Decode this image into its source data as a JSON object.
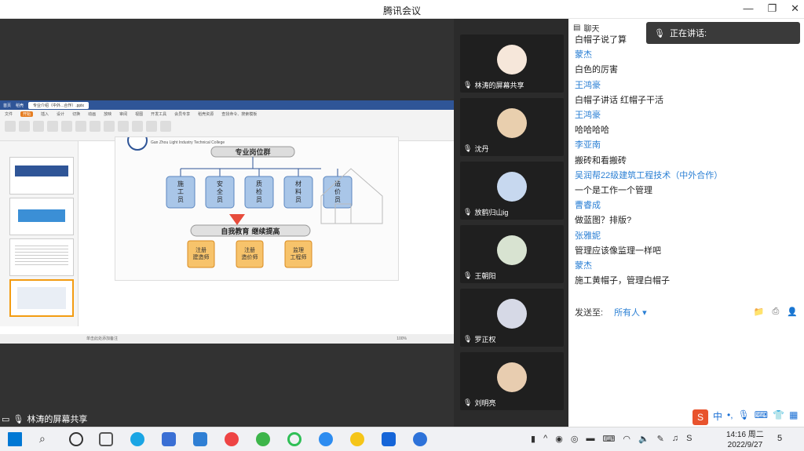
{
  "window": {
    "title": "腾讯会议"
  },
  "share": {
    "label": "林涛的屏幕共享",
    "tabs": [
      "首页",
      "稻壳",
      "专业介绍（中外...合作）.pptx"
    ],
    "ribbon_menu": [
      "文件",
      "开始",
      "插入",
      "设计",
      "切换",
      "动画",
      "放映",
      "审阅",
      "视图",
      "开发工具",
      "会员专享",
      "稻壳资源",
      "查找命令、搜索模板"
    ],
    "slide": {
      "college": "Gan Zhou Light Industry Technical College",
      "title": "专业岗位群",
      "roles": [
        "施工员",
        "安全员",
        "质检员",
        "材料员",
        "造价员"
      ],
      "subtitle": "自我教育 继续提高",
      "goals": [
        "注册建造师",
        "注册造价师",
        "监理工程师"
      ]
    },
    "status_text": "单击此处添加备注",
    "zoom": "100%"
  },
  "participants": [
    {
      "name": "林涛的屏幕共享",
      "color": "#f6e7da"
    },
    {
      "name": "沈丹",
      "color": "#e9cfae"
    },
    {
      "name": "放鹤归山ig",
      "color": "#c7d8ef"
    },
    {
      "name": "王朝阳",
      "color": "#d8e3d1"
    },
    {
      "name": "罗正权",
      "color": "#d6d9e6"
    },
    {
      "name": "刘明亮",
      "color": "#e8cdb0"
    }
  ],
  "chat": {
    "header": "聊天",
    "speaking": "正在讲话:",
    "messages": [
      {
        "text": "白帽子说了算",
        "kind": "m"
      },
      {
        "text": "蒙杰",
        "kind": "n"
      },
      {
        "text": "白色的厉害",
        "kind": "m"
      },
      {
        "text": "王鸿豪",
        "kind": "n"
      },
      {
        "text": "白帽子讲话 红帽子干活",
        "kind": "m"
      },
      {
        "text": "王鸿豪",
        "kind": "n"
      },
      {
        "text": "哈哈哈哈",
        "kind": "m"
      },
      {
        "text": "李亚南",
        "kind": "n"
      },
      {
        "text": "搬砖和看搬砖",
        "kind": "m"
      },
      {
        "text": "吴润帮22级建筑工程技术（中外合作）",
        "kind": "n"
      },
      {
        "text": "一个是工作一个管理",
        "kind": "m"
      },
      {
        "text": "曹睿成",
        "kind": "n"
      },
      {
        "text": "做蓝图？排版?",
        "kind": "m"
      },
      {
        "text": "张雅妮",
        "kind": "n"
      },
      {
        "text": "管理应该像监理一样吧",
        "kind": "m"
      },
      {
        "text": "蒙杰",
        "kind": "n"
      },
      {
        "text": "施工黄帽子，管理白帽子",
        "kind": "m"
      }
    ],
    "send_label": "发送至:",
    "send_to": "所有人 ▾"
  },
  "taskbar": {
    "time": "14:16 周二",
    "date": "2022/9/27",
    "badge": "5"
  },
  "ime": {
    "lang": "中"
  }
}
